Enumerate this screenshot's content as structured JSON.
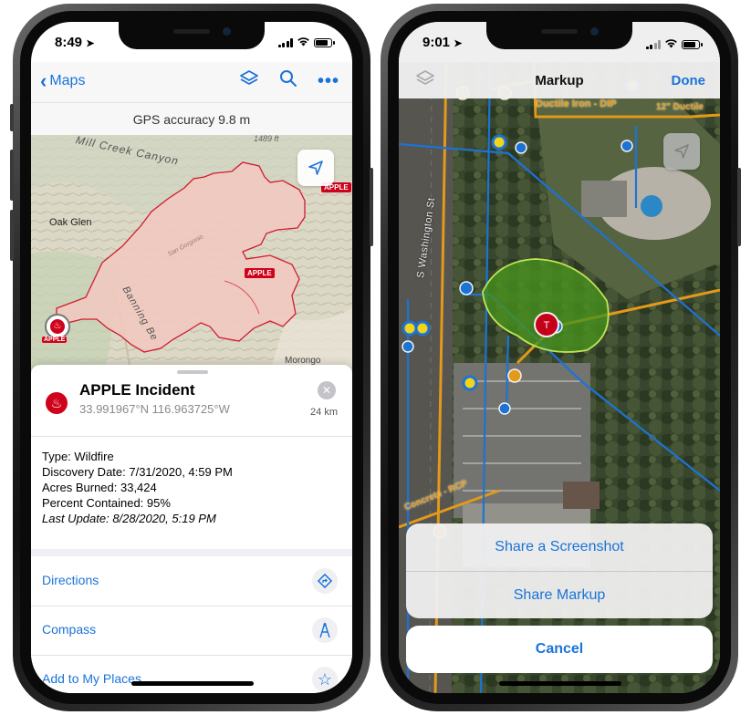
{
  "left_phone": {
    "status": {
      "time": "8:49"
    },
    "navbar": {
      "back_label": "Maps"
    },
    "gps_text": "GPS accuracy 9.8 m",
    "map_labels": {
      "canyon": "Mill Creek Canyon",
      "elevation": "1489 ft",
      "oak_glen": "Oak Glen",
      "fire_label_top": "APPLE",
      "fire_label_mid": "APPLE",
      "fire_label_left": "APPLE",
      "river": "San Gorgonio",
      "banning": "Banning Be",
      "morongo": "Morongo"
    },
    "incident": {
      "title": "APPLE Incident",
      "coords": "33.991967°N 116.963725°W",
      "distance": "24 km"
    },
    "details": {
      "type": "Type: Wildfire",
      "discovery": "Discovery Date: 7/31/2020, 4:59 PM",
      "acres": "Acres Burned: 33,424",
      "contained": "Percent Contained: 95%",
      "updated": "Last Update: 8/28/2020, 5:19 PM"
    },
    "actions": [
      {
        "label": "Directions",
        "icon": "directions-icon"
      },
      {
        "label": "Compass",
        "icon": "compass-icon"
      },
      {
        "label": "Add to My Places",
        "icon": "star-icon"
      }
    ]
  },
  "right_phone": {
    "status": {
      "time": "9:01"
    },
    "navbar": {
      "title": "Markup",
      "done": "Done"
    },
    "map_labels": {
      "street": "S Washington St",
      "pipe_top": "Ductile Iron - DIP",
      "pipe_bottom": "Concrete - RCP",
      "pipe_right": "12\" Ductile"
    },
    "share_sheet": {
      "option_screenshot": "Share a Screenshot",
      "option_markup": "Share Markup",
      "cancel": "Cancel"
    }
  },
  "colors": {
    "accent": "#1a73d9",
    "fire_red": "#d0021b",
    "fire_fill": "#f2c9c0",
    "pipe_orange": "#f0a21b",
    "pipe_blue": "#1f7ae0",
    "markup_green": "#4c9a1f"
  }
}
